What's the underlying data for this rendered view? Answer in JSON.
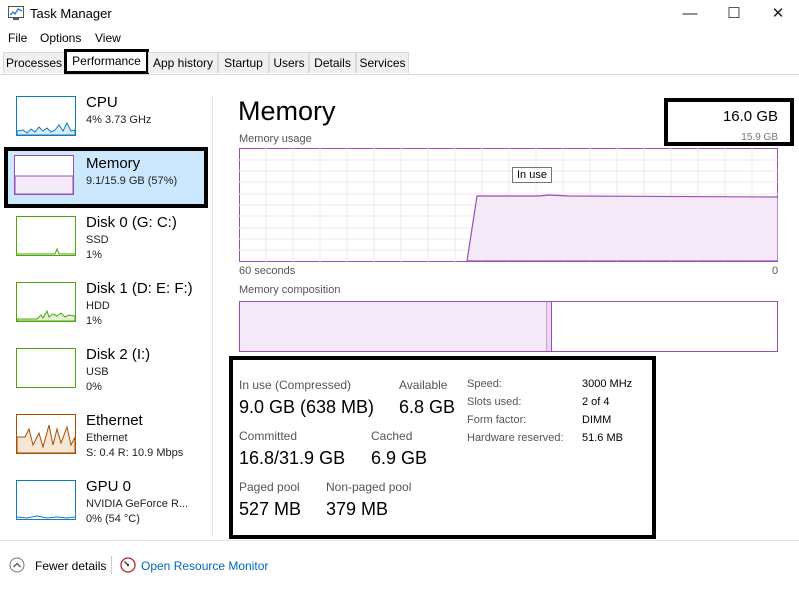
{
  "window": {
    "title": "Task Manager",
    "minimize": "—",
    "maximize": "☐",
    "close": "✕"
  },
  "menu": {
    "file": "File",
    "options": "Options",
    "view": "View"
  },
  "tabs": [
    {
      "label": "Processes"
    },
    {
      "label": "Performance"
    },
    {
      "label": "App history"
    },
    {
      "label": "Startup"
    },
    {
      "label": "Users"
    },
    {
      "label": "Details"
    },
    {
      "label": "Services"
    }
  ],
  "sidebar": {
    "cpu": {
      "name": "CPU",
      "line1": "4% 3.73 GHz"
    },
    "memory": {
      "name": "Memory",
      "line1": "9.1/15.9 GB (57%)"
    },
    "disk0": {
      "name": "Disk 0 (G: C:)",
      "line1": "SSD",
      "line2": "1%"
    },
    "disk1": {
      "name": "Disk 1 (D: E: F:)",
      "line1": "HDD",
      "line2": "1%"
    },
    "disk2": {
      "name": "Disk 2 (I:)",
      "line1": "USB",
      "line2": "0%"
    },
    "ethernet": {
      "name": "Ethernet",
      "line1": "Ethernet",
      "line2": "S: 0.4 R: 10.9 Mbps"
    },
    "gpu": {
      "name": "GPU 0",
      "line1": "NVIDIA GeForce R...",
      "line2": "0% (54 °C)"
    }
  },
  "main": {
    "title": "Memory",
    "capacity": "16.0 GB",
    "capacity_usable": "15.9 GB",
    "usage_label": "Memory usage",
    "tooltip": "In use",
    "x_left": "60 seconds",
    "x_right": "0",
    "composition_label": "Memory composition",
    "in_use_fraction": 0.57
  },
  "stats": {
    "in_use_label": "In use (Compressed)",
    "in_use_value": "9.0 GB (638 MB)",
    "available_label": "Available",
    "available_value": "6.8 GB",
    "committed_label": "Committed",
    "committed_value": "16.8/31.9 GB",
    "cached_label": "Cached",
    "cached_value": "6.9 GB",
    "paged_label": "Paged pool",
    "paged_value": "527 MB",
    "nonpaged_label": "Non-paged pool",
    "nonpaged_value": "379 MB",
    "speed_label": "Speed:",
    "speed_value": "3000 MHz",
    "slots_label": "Slots used:",
    "slots_value": "2 of 4",
    "form_label": "Form factor:",
    "form_value": "DIMM",
    "reserved_label": "Hardware reserved:",
    "reserved_value": "51.6 MB"
  },
  "footer": {
    "fewer": "Fewer details",
    "monitor": "Open Resource Monitor"
  },
  "colors": {
    "memory": "#9b4fb5",
    "cpu": "#117dbb",
    "disk": "#4da60c",
    "ethernet": "#a74f01",
    "gpu": "#117dbb",
    "selected": "#cce8ff"
  }
}
